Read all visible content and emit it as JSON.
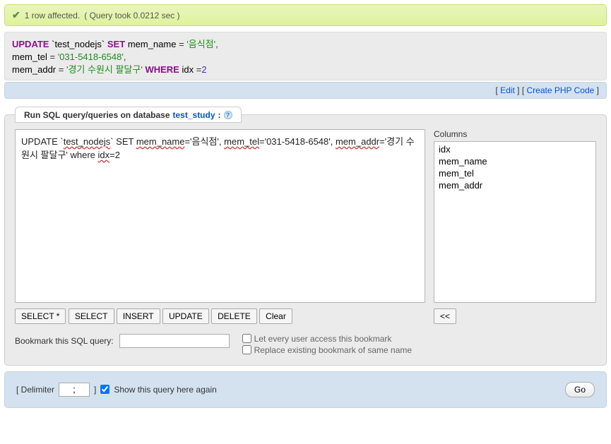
{
  "success": {
    "rows_affected": "1 row affected.",
    "timing": "( Query took 0.0212 sec )"
  },
  "sql_display": {
    "kw_update": "UPDATE",
    "table": "`test_nodejs`",
    "kw_set": "SET",
    "col1": "mem_name",
    "eq": " = ",
    "val1": "'음식점'",
    "col2": "mem_tel",
    "val2": "'031-5418-6548'",
    "col3": "mem_addr",
    "val3": "'경기 수원시 팔달구'",
    "kw_where": "WHERE",
    "col_idx": "idx",
    "eqnum": " =",
    "val_idx": "2",
    "comma": ","
  },
  "links": {
    "edit": "Edit",
    "create_php": "Create PHP Code"
  },
  "legend": {
    "prefix": "Run SQL query/queries on database ",
    "dbname": "test_study",
    "colon": ":"
  },
  "textarea_value": "UPDATE `test_nodejs` SET mem_name='음식점', mem_tel='031-5418-6548', mem_addr='경기 수원시 팔달구' where idx=2",
  "columns": {
    "label": "Columns",
    "items": [
      "idx",
      "mem_name",
      "mem_tel",
      "mem_addr"
    ],
    "insert_btn": "<<"
  },
  "buttons": {
    "select_star": "SELECT *",
    "select": "SELECT",
    "insert": "INSERT",
    "update": "UPDATE",
    "delete": "DELETE",
    "clear": "Clear"
  },
  "bookmark": {
    "label": "Bookmark this SQL query:",
    "value": "",
    "opt_public": "Let every user access this bookmark",
    "opt_replace": "Replace existing bookmark of same name"
  },
  "footer": {
    "delimiter_label_open": "[ Delimiter",
    "delimiter_value": ";",
    "delimiter_close": "]",
    "show_again": "Show this query here again",
    "show_again_checked": true,
    "go": "Go"
  }
}
